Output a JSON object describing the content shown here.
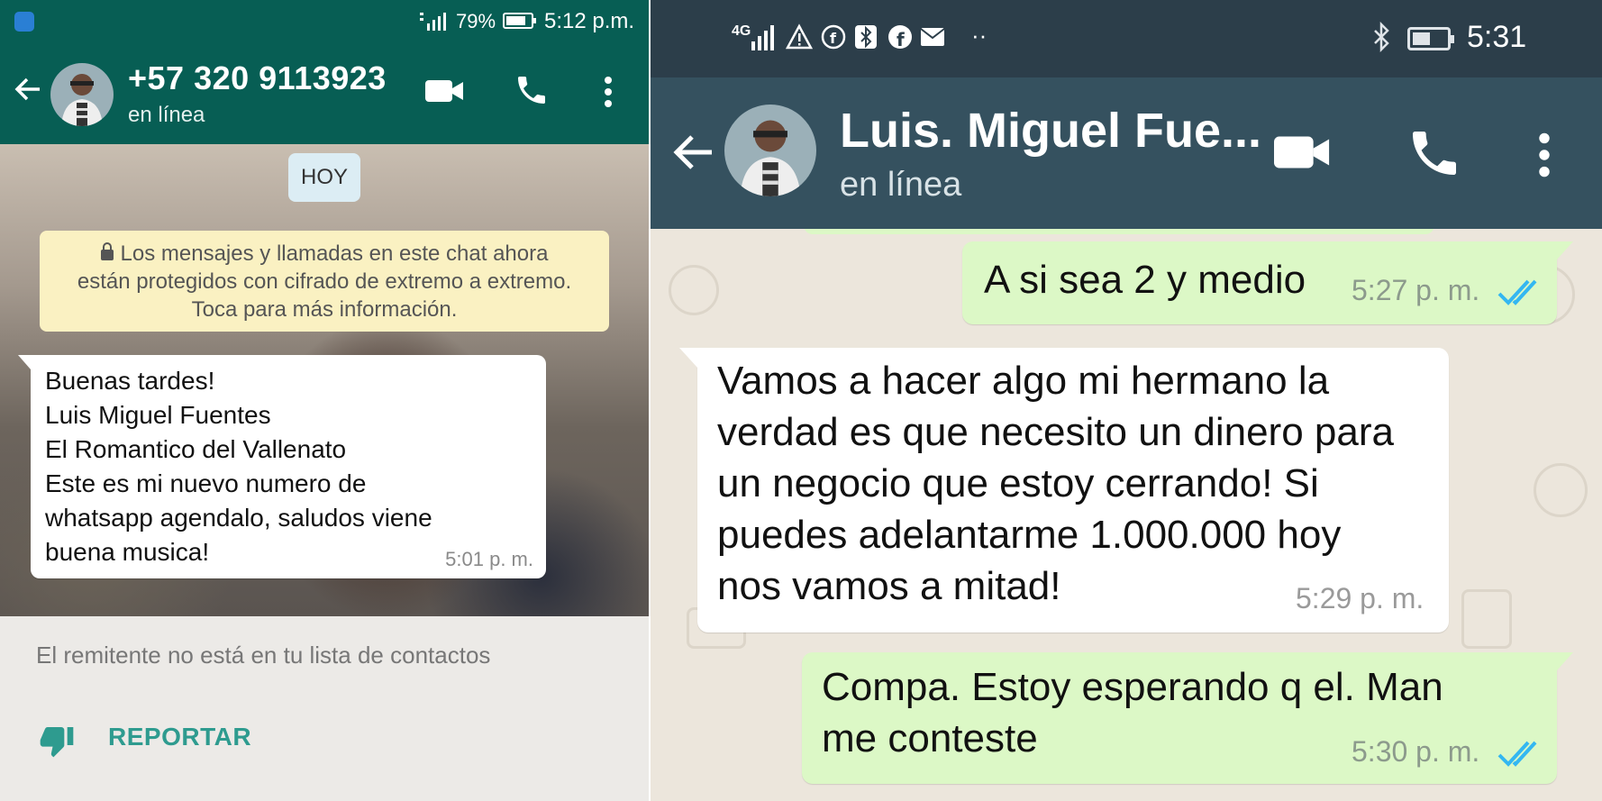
{
  "left": {
    "status": {
      "battery": "79%",
      "time": "5:12 p.m."
    },
    "header": {
      "title": "+57 320 9113923",
      "subtitle": "en línea"
    },
    "day_label": "HOY",
    "encryption_lines": [
      "Los mensajes y llamadas en este chat ahora",
      "están protegidos con cifrado de extremo a extremo.",
      "Toca para más información."
    ],
    "message": {
      "lines": [
        "Buenas tardes!",
        "Luis Miguel Fuentes",
        "El Romantico del Vallenato",
        "Este es mi nuevo numero de",
        "whatsapp agendalo, saludos viene",
        "buena musica!"
      ],
      "time": "5:01 p. m."
    },
    "notice": {
      "text": "El remitente no está en tu lista de contactos",
      "report_label": "REPORTAR"
    }
  },
  "right": {
    "status": {
      "network": "4G",
      "time": "5:31"
    },
    "header": {
      "title": "Luis. Miguel Fue...",
      "subtitle": "en línea"
    },
    "messages": [
      {
        "direction": "out",
        "lines": [
          "A si sea 2 y medio"
        ],
        "time": "5:27 p. m.",
        "read": true
      },
      {
        "direction": "in",
        "lines": [
          "Vamos a hacer algo mi hermano la",
          "verdad es que necesito un dinero para",
          "un negocio que estoy cerrando! Si",
          "puedes adelantarme 1.000.000 hoy",
          "nos vamos a mitad!"
        ],
        "time": "5:29 p. m."
      },
      {
        "direction": "out",
        "lines": [
          "Compa. Estoy esperando q el. Man",
          "me conteste"
        ],
        "time": "5:30 p. m.",
        "read": true
      }
    ]
  },
  "colors": {
    "left_header": "#075e54",
    "right_header": "#35515f",
    "outgoing_bubble": "#dcf8c6",
    "read_tick": "#34b7f1",
    "report": "#2e9b8f"
  }
}
